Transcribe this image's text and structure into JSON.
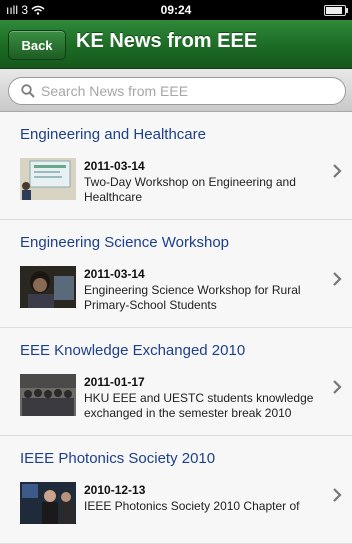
{
  "status_bar": {
    "signal_text": "ııll 3",
    "time": "09:24"
  },
  "nav": {
    "back_label": "Back",
    "title": "KE News from EEE",
    "accent": "#1c6b25"
  },
  "search": {
    "placeholder": "Search News from EEE",
    "value": ""
  },
  "news": [
    {
      "title": "Engineering and Healthcare",
      "date": "2011-03-14",
      "description": "Two-Day Workshop on Engineering and Healthcare"
    },
    {
      "title": "Engineering Science Workshop",
      "date": "2011-03-14",
      "description": "Engineering Science Workshop for Rural Primary-School Students"
    },
    {
      "title": "EEE Knowledge Exchanged 2010",
      "date": "2011-01-17",
      "description": "HKU EEE and UESTC students knowledge exchanged in the semester break 2010"
    },
    {
      "title": "IEEE Photonics Society 2010",
      "date": "2010-12-13",
      "description": "IEEE Photonics Society 2010 Chapter of"
    }
  ],
  "title_color": "#1d3f8c"
}
